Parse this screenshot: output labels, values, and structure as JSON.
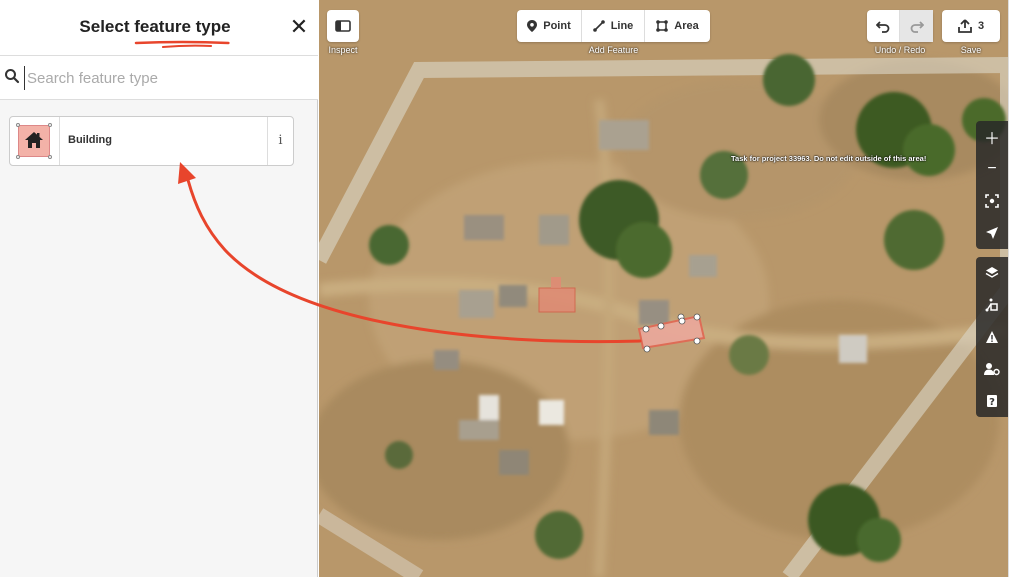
{
  "sidebar": {
    "title_prefix": "Select ",
    "title_highlight": "feature type",
    "close_glyph": "✕",
    "search_placeholder": "Search feature type",
    "presets": [
      {
        "label": "Building",
        "icon": "house-icon",
        "info_glyph": "i"
      }
    ]
  },
  "toolbar": {
    "inspect_caption": "Inspect",
    "add_feature_caption": "Add Feature",
    "modes": [
      {
        "label": "Point",
        "icon": "point-icon"
      },
      {
        "label": "Line",
        "icon": "line-icon"
      },
      {
        "label": "Area",
        "icon": "area-icon"
      }
    ],
    "undo_redo_caption": "Undo / Redo",
    "save_caption": "Save",
    "save_count": "3"
  },
  "map": {
    "task_message": "Task for project 33963. Do not edit outside of this area!",
    "controls": [
      "zoom-in-icon",
      "zoom-out-icon",
      "zoom-to-selection-icon",
      "geolocate-icon",
      "layers-icon",
      "map-data-icon",
      "issues-icon",
      "preferences-icon",
      "help-icon"
    ]
  },
  "colors": {
    "accent_red": "#e8452c",
    "building_fill": "#f3b2a8",
    "toolbar_bg": "#ffffff"
  }
}
